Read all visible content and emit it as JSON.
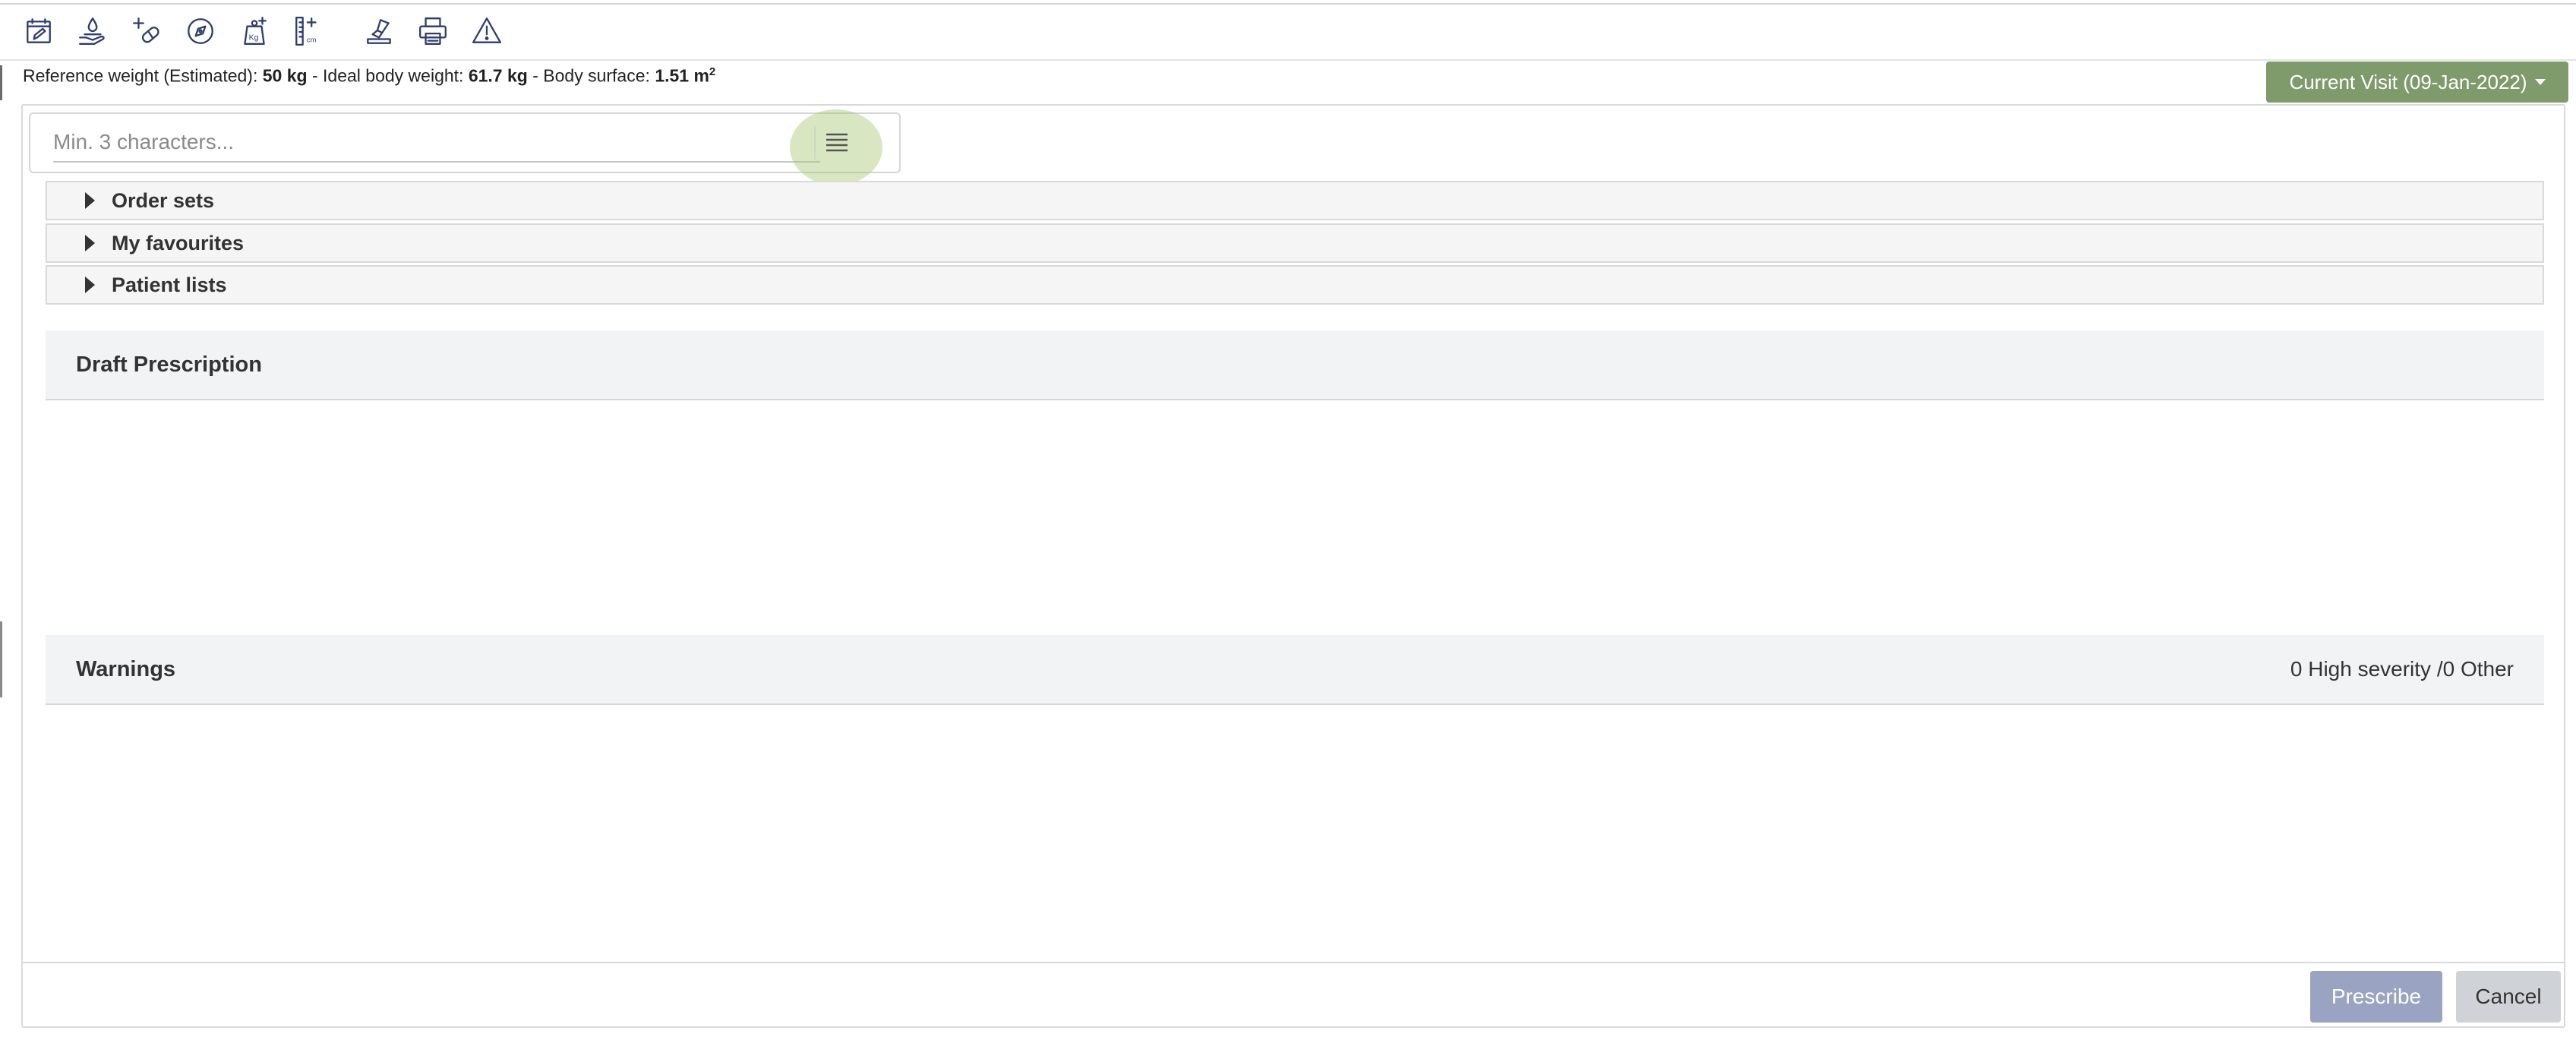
{
  "toolbar": {
    "icons": [
      "calendar-edit-icon",
      "hand-drop-icon",
      "add-medication-icon",
      "compass-icon",
      "weight-add-icon",
      "height-add-icon",
      "stamp-icon",
      "printer-icon",
      "warning-icon"
    ],
    "weight_unit": "Kg",
    "height_unit": "cm"
  },
  "patient_metrics": {
    "ref_weight_label": "Reference weight (Estimated):",
    "ref_weight_value": "50 kg",
    "sep1": " - ",
    "ideal_weight_label": "Ideal body weight:",
    "ideal_weight_value": "61.7 kg",
    "sep2": " - ",
    "body_surface_label": "Body surface:",
    "body_surface_value": "1.51 m",
    "body_surface_exp": "2"
  },
  "visit": {
    "label": "Current Visit (09-Jan-2022)"
  },
  "search": {
    "placeholder": "Min. 3 characters..."
  },
  "accordion": [
    {
      "label": "Order sets"
    },
    {
      "label": "My favourites"
    },
    {
      "label": "Patient lists"
    }
  ],
  "draft": {
    "title": "Draft Prescription"
  },
  "warnings": {
    "title": "Warnings",
    "count": "0 High severity /0 Other"
  },
  "footer": {
    "prescribe_label": "Prescribe",
    "cancel_label": "Cancel"
  },
  "colors": {
    "visit_button": "#7f9a6b",
    "prescribe_button": "#9aa3c2",
    "cancel_button": "#cfd3d7",
    "icon": "#2f3d6e"
  }
}
